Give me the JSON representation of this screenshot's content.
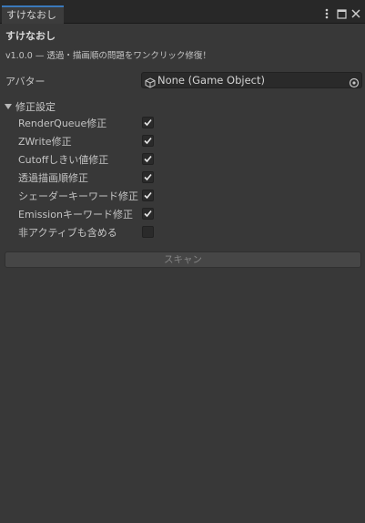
{
  "window": {
    "tab_title": "すけなおし",
    "controls": [
      "more-icon",
      "maximize-icon",
      "close-icon"
    ]
  },
  "header": {
    "title": "すけなおし",
    "subtitle": "v1.0.0 — 透過・描画順の問題をワンクリック修復！"
  },
  "avatar": {
    "label": "アバター",
    "value": "None (Game Object)"
  },
  "settings": {
    "label": "修正設定",
    "expanded": true,
    "items": [
      {
        "label": "RenderQueue修正",
        "checked": true
      },
      {
        "label": "ZWrite修正",
        "checked": true
      },
      {
        "label": "Cutoffしきい値修正",
        "checked": true
      },
      {
        "label": "透過描画順修正",
        "checked": true
      },
      {
        "label": "シェーダーキーワード修正",
        "checked": true
      },
      {
        "label": "Emissionキーワード修正",
        "checked": true
      },
      {
        "label": "非アクティブも含める",
        "checked": false
      }
    ]
  },
  "scan_button": {
    "label": "スキャン",
    "enabled": false
  },
  "colors": {
    "background": "#383838",
    "field": "#2a2a2a",
    "accent": "#3a79bb"
  }
}
